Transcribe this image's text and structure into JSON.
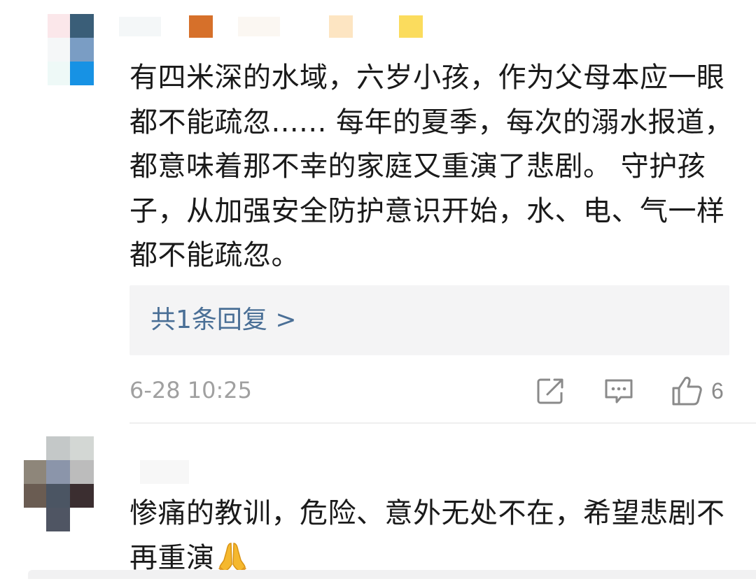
{
  "comments": [
    {
      "text": "有四米深的水域，六岁小孩，作为父母本应一眼都不能疏忽...... 每年的夏季，每次的溺水报道，都意味着那不幸的家庭又重演了悲剧。 守护孩子，从加强安全防护意识开始，水、电、气一样都不能疏忽。",
      "reply_link": "共1条回复 >",
      "timestamp": "6-28 10:25",
      "likes": "6",
      "actions": [
        "share-icon",
        "comment-icon",
        "thumbs-up-icon"
      ]
    },
    {
      "text": "惨痛的教训，危险、意外无处不在，希望悲剧不再重演",
      "emoji": "folded-hands-emoji"
    }
  ],
  "colors": {
    "text": "#1a1a1a",
    "link": "#4a6f96",
    "meta": "#a0a0a0",
    "reply_bg": "#f4f4f5"
  }
}
